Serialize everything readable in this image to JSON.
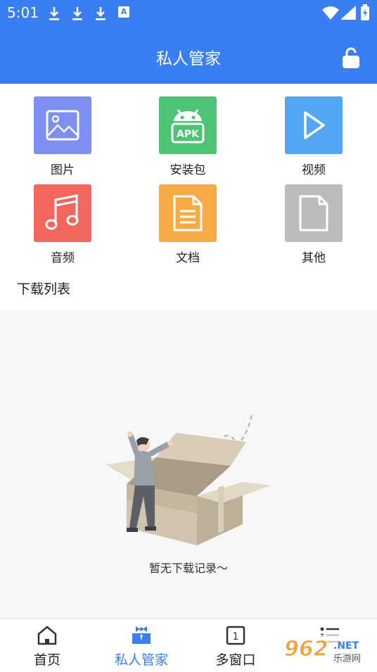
{
  "status_bar": {
    "time": "5:01",
    "notification_icons": [
      "download-icon",
      "download-icon",
      "download-icon",
      "a-app-icon"
    ],
    "a_app_glyph": "A"
  },
  "header": {
    "title": "私人管家",
    "right_icon": "lock-open-icon"
  },
  "categories": [
    {
      "label": "图片",
      "icon": "image-icon",
      "color": "#7b8ff5"
    },
    {
      "label": "安装包",
      "icon": "apk-icon",
      "color": "#4cc473",
      "icon_text": "APK"
    },
    {
      "label": "视频",
      "icon": "play-icon",
      "color": "#53a5f5"
    },
    {
      "label": "音频",
      "icon": "music-icon",
      "color": "#f3665d"
    },
    {
      "label": "文档",
      "icon": "document-icon",
      "color": "#f8ab44"
    },
    {
      "label": "其他",
      "icon": "file-icon",
      "color": "#bcbcbc"
    }
  ],
  "section": {
    "title": "下载列表"
  },
  "empty_state": {
    "text": "暂无下载记录～"
  },
  "bottom_nav": [
    {
      "label": "首页",
      "icon": "home-icon",
      "active": false
    },
    {
      "label": "私人管家",
      "icon": "butler-icon",
      "active": true
    },
    {
      "label": "多窗口",
      "icon": "window-icon",
      "active": false,
      "icon_text": "1"
    },
    {
      "label": "",
      "icon": "menu-list-icon",
      "active": false
    }
  ],
  "watermark": {
    "text": "962",
    "sub_text": ".NET",
    "site_text": "乐游网"
  },
  "colors": {
    "primary": "#3a7ef4",
    "background": "#f7f7f7"
  }
}
